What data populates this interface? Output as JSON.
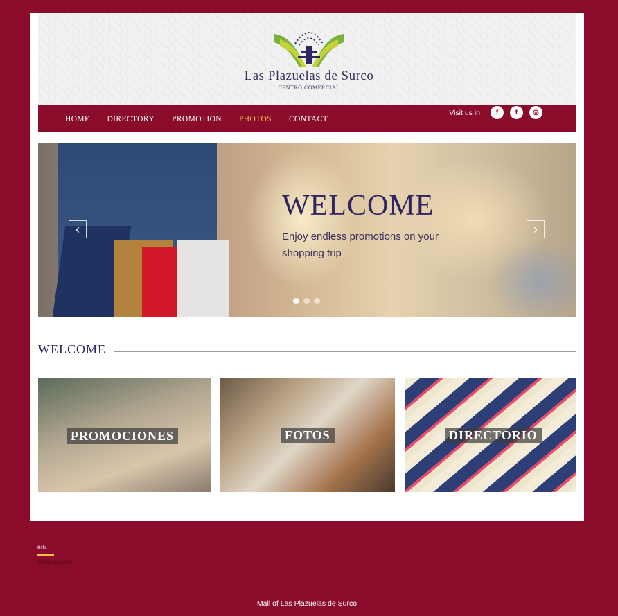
{
  "brand": {
    "name": "Las Plazuelas de Surco",
    "subtitle": "CENTRO COMERCIAL"
  },
  "nav": {
    "items": [
      {
        "label": "HOME",
        "active": false
      },
      {
        "label": "DIRECTORY",
        "active": false
      },
      {
        "label": "PROMOTION",
        "active": false
      },
      {
        "label": "PHOTOS",
        "active": true
      },
      {
        "label": "CONTACT",
        "active": false
      }
    ]
  },
  "social": {
    "label": "Visit us in",
    "icons": [
      "facebook-icon",
      "twitter-icon",
      "instagram-icon"
    ],
    "glyphs": [
      "f",
      "t",
      "◎"
    ]
  },
  "slider": {
    "title": "WELCOME",
    "text": "Enjoy endless promotions on your shopping trip",
    "prev_glyph": "‹",
    "next_glyph": "›",
    "active_dot": 1,
    "dot_count": 3
  },
  "section": {
    "title": "WELCOME"
  },
  "tiles": [
    {
      "label": "PROMOCIONES"
    },
    {
      "label": "FOTOS"
    },
    {
      "label": "DIRECTORIO"
    }
  ],
  "footer": {
    "title": "titlr",
    "body": "sdfdsafdsfd",
    "copyright": "Mall of Las Plazuelas de Surco"
  },
  "colors": {
    "brand": "#8a0c2a",
    "accent": "#f0c24b",
    "text": "#2f2562"
  }
}
